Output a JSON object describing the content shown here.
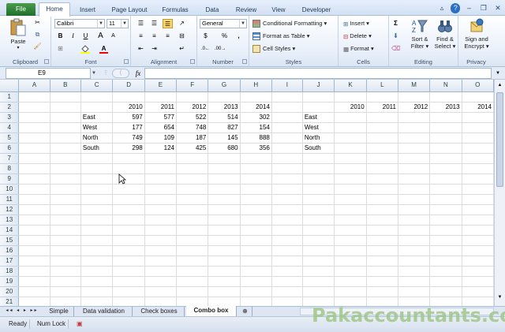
{
  "ribbon_tabs": [
    "File",
    "Home",
    "Insert",
    "Page Layout",
    "Formulas",
    "Data",
    "Review",
    "View",
    "Developer"
  ],
  "clipboard": {
    "paste": "Paste",
    "label": "Clipboard"
  },
  "font": {
    "family": "Calibri",
    "size": "11",
    "bold": "B",
    "italic": "I",
    "underline": "U",
    "fill_icon": "fill-color-icon",
    "font_color_icon": "font-color-icon",
    "label": "Font"
  },
  "alignment": {
    "label": "Alignment"
  },
  "number": {
    "format": "General",
    "currency": "$",
    "percent": "%",
    "comma": ",",
    "label": "Number"
  },
  "styles": {
    "conditional": "Conditional Formatting",
    "format_table": "Format as Table",
    "cell_styles": "Cell Styles",
    "label": "Styles"
  },
  "cells": {
    "insert": "Insert",
    "delete": "Delete",
    "format": "Format",
    "label": "Cells"
  },
  "editing": {
    "sum": "Σ",
    "sort": "Sort &",
    "filter": "Filter",
    "find": "Find &",
    "select": "Select",
    "label": "Editing"
  },
  "privacy": {
    "sign": "Sign and",
    "encrypt": "Encrypt",
    "label": "Privacy"
  },
  "formula_bar": {
    "name_box": "E9",
    "fx": "fx",
    "formula": ""
  },
  "columns": [
    "A",
    "B",
    "C",
    "D",
    "E",
    "F",
    "G",
    "H",
    "I",
    "J",
    "K",
    "L",
    "M",
    "N",
    "O"
  ],
  "rows": [
    {
      "n": "1",
      "c": [
        "",
        "",
        "",
        "",
        "",
        "",
        "",
        "",
        "",
        "",
        "",
        "",
        "",
        "",
        ""
      ]
    },
    {
      "n": "2",
      "c": [
        "",
        "",
        "",
        "2010",
        "2011",
        "2012",
        "2013",
        "2014",
        "",
        "",
        "2010",
        "2011",
        "2012",
        "2013",
        "2014"
      ]
    },
    {
      "n": "3",
      "c": [
        "",
        "",
        "East",
        "597",
        "577",
        "522",
        "514",
        "302",
        "",
        "East",
        "",
        "",
        "",
        "",
        ""
      ]
    },
    {
      "n": "4",
      "c": [
        "",
        "",
        "West",
        "177",
        "654",
        "748",
        "827",
        "154",
        "",
        "West",
        "",
        "",
        "",
        "",
        ""
      ]
    },
    {
      "n": "5",
      "c": [
        "",
        "",
        "North",
        "749",
        "109",
        "187",
        "145",
        "888",
        "",
        "North",
        "",
        "",
        "",
        "",
        ""
      ]
    },
    {
      "n": "6",
      "c": [
        "",
        "",
        "South",
        "298",
        "124",
        "425",
        "680",
        "356",
        "",
        "South",
        "",
        "",
        "",
        "",
        ""
      ]
    },
    {
      "n": "7",
      "c": [
        "",
        "",
        "",
        "",
        "",
        "",
        "",
        "",
        "",
        "",
        "",
        "",
        "",
        "",
        ""
      ]
    },
    {
      "n": "8",
      "c": [
        "",
        "",
        "",
        "",
        "",
        "",
        "",
        "",
        "",
        "",
        "",
        "",
        "",
        "",
        ""
      ]
    },
    {
      "n": "9",
      "c": [
        "",
        "",
        "",
        "",
        "",
        "",
        "",
        "",
        "",
        "",
        "",
        "",
        "",
        "",
        ""
      ]
    },
    {
      "n": "10",
      "c": [
        "",
        "",
        "",
        "",
        "",
        "",
        "",
        "",
        "",
        "",
        "",
        "",
        "",
        "",
        ""
      ]
    },
    {
      "n": "11",
      "c": [
        "",
        "",
        "",
        "",
        "",
        "",
        "",
        "",
        "",
        "",
        "",
        "",
        "",
        "",
        ""
      ]
    },
    {
      "n": "12",
      "c": [
        "",
        "",
        "",
        "",
        "",
        "",
        "",
        "",
        "",
        "",
        "",
        "",
        "",
        "",
        ""
      ]
    },
    {
      "n": "13",
      "c": [
        "",
        "",
        "",
        "",
        "",
        "",
        "",
        "",
        "",
        "",
        "",
        "",
        "",
        "",
        ""
      ]
    },
    {
      "n": "14",
      "c": [
        "",
        "",
        "",
        "",
        "",
        "",
        "",
        "",
        "",
        "",
        "",
        "",
        "",
        "",
        ""
      ]
    },
    {
      "n": "15",
      "c": [
        "",
        "",
        "",
        "",
        "",
        "",
        "",
        "",
        "",
        "",
        "",
        "",
        "",
        "",
        ""
      ]
    },
    {
      "n": "16",
      "c": [
        "",
        "",
        "",
        "",
        "",
        "",
        "",
        "",
        "",
        "",
        "",
        "",
        "",
        "",
        ""
      ]
    },
    {
      "n": "17",
      "c": [
        "",
        "",
        "",
        "",
        "",
        "",
        "",
        "",
        "",
        "",
        "",
        "",
        "",
        "",
        ""
      ]
    },
    {
      "n": "18",
      "c": [
        "",
        "",
        "",
        "",
        "",
        "",
        "",
        "",
        "",
        "",
        "",
        "",
        "",
        "",
        ""
      ]
    },
    {
      "n": "19",
      "c": [
        "",
        "",
        "",
        "",
        "",
        "",
        "",
        "",
        "",
        "",
        "",
        "",
        "",
        "",
        ""
      ]
    },
    {
      "n": "20",
      "c": [
        "",
        "",
        "",
        "",
        "",
        "",
        "",
        "",
        "",
        "",
        "",
        "",
        "",
        "",
        ""
      ]
    },
    {
      "n": "21",
      "c": [
        "",
        "",
        "",
        "",
        "",
        "",
        "",
        "",
        "",
        "",
        "",
        "",
        "",
        "",
        ""
      ]
    }
  ],
  "sheet_tabs": [
    "Simple",
    "Data validation",
    "Check boxes",
    "Combo box"
  ],
  "active_sheet": "Combo box",
  "status": {
    "ready": "Ready",
    "numlock": "Num Lock"
  },
  "watermark": "Pakaccountants.com",
  "colors": {
    "accent": "#2b579a",
    "file_tab": "#217346",
    "grid": "#dadcdd"
  }
}
